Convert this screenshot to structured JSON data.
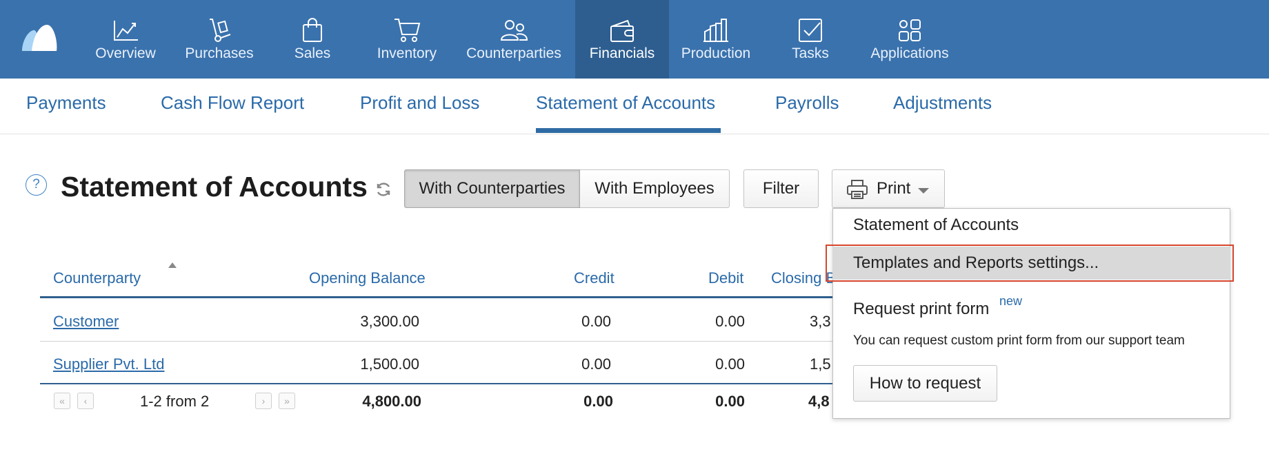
{
  "nav": {
    "items": [
      {
        "label": "Overview",
        "icon": "chart-line-icon"
      },
      {
        "label": "Purchases",
        "icon": "hand-truck-icon"
      },
      {
        "label": "Sales",
        "icon": "shopping-bag-icon"
      },
      {
        "label": "Inventory",
        "icon": "cart-icon"
      },
      {
        "label": "Counterparties",
        "icon": "people-icon"
      },
      {
        "label": "Financials",
        "icon": "wallet-icon",
        "active": true
      },
      {
        "label": "Production",
        "icon": "factory-icon"
      },
      {
        "label": "Tasks",
        "icon": "checkbox-icon"
      },
      {
        "label": "Applications",
        "icon": "apps-grid-icon"
      }
    ]
  },
  "subtabs": {
    "items": [
      {
        "label": "Payments"
      },
      {
        "label": "Cash Flow Report"
      },
      {
        "label": "Profit and Loss"
      },
      {
        "label": "Statement of Accounts",
        "active": true
      },
      {
        "label": "Payrolls"
      },
      {
        "label": "Adjustments"
      }
    ]
  },
  "header": {
    "help": "?",
    "title": "Statement of Accounts",
    "with_counterparties": "With Counterparties",
    "with_employees": "With Employees",
    "filter": "Filter",
    "print": "Print"
  },
  "table": {
    "columns": [
      "Counterparty",
      "Opening Balance",
      "Credit",
      "Debit",
      "Closing B"
    ],
    "rows": [
      {
        "counterparty": "Customer",
        "opening": "3,300.00",
        "credit": "0.00",
        "debit": "0.00",
        "closing": "3,3"
      },
      {
        "counterparty": "Supplier Pvt. Ltd",
        "opening": "1,500.00",
        "credit": "0.00",
        "debit": "0.00",
        "closing": "1,5"
      }
    ],
    "totals": {
      "pager": "1-2 from 2",
      "opening": "4,800.00",
      "credit": "0.00",
      "debit": "0.00",
      "closing": "4,8"
    }
  },
  "print_menu": {
    "item1": "Statement of Accounts",
    "item2": "Templates and Reports settings...",
    "item3": "Request print form",
    "new_badge": "new",
    "note": "You can request custom print form from our support team",
    "how_button": "How to request"
  },
  "colors": {
    "topbar": "#3a72ad",
    "topbar_active": "#2e5e90",
    "link": "#2a6aa9",
    "highlight_outline": "#d8452c"
  }
}
